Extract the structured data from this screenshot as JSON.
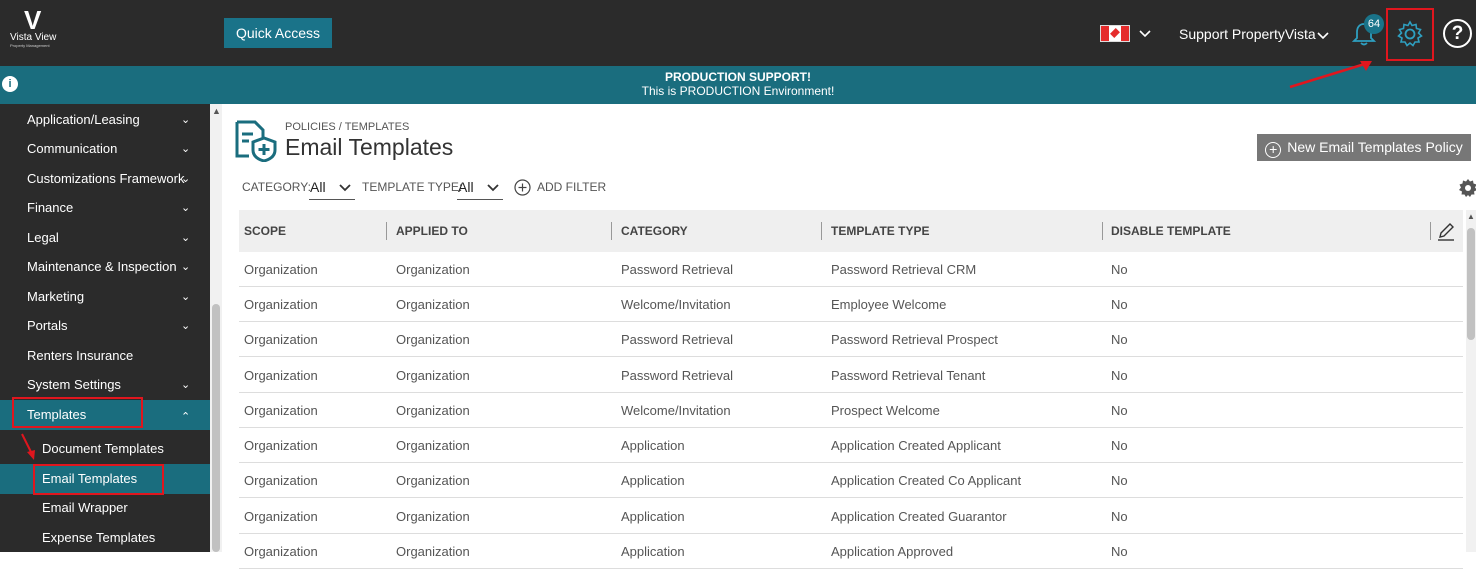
{
  "logo": {
    "mark": "V",
    "line1": "Vista View",
    "line2": "Property Management"
  },
  "topbar": {
    "quick_access": "Quick Access",
    "account": "Support PropertyVista",
    "notifications": "64",
    "help": "?"
  },
  "banner": {
    "line1": "PRODUCTION SUPPORT!",
    "line2": "This is PRODUCTION Environment!",
    "info": "i"
  },
  "sidebar": {
    "items": [
      {
        "label": "Application/Leasing"
      },
      {
        "label": "Communication"
      },
      {
        "label": "Customizations Framework"
      },
      {
        "label": "Finance"
      },
      {
        "label": "Legal"
      },
      {
        "label": "Maintenance & Inspection"
      },
      {
        "label": "Marketing"
      },
      {
        "label": "Portals"
      },
      {
        "label": "Renters Insurance"
      },
      {
        "label": "System Settings"
      },
      {
        "label": "Templates"
      }
    ],
    "subitems": [
      {
        "label": "Document Templates"
      },
      {
        "label": "Email Templates"
      },
      {
        "label": "Email Wrapper"
      },
      {
        "label": "Expense Templates"
      }
    ]
  },
  "page": {
    "breadcrumb": "POLICIES / TEMPLATES",
    "title": "Email Templates",
    "new_button": "New Email Templates Policy"
  },
  "filters": {
    "category_label": "CATEGORY:",
    "category_value": "All",
    "type_label": "TEMPLATE TYPE:",
    "type_value": "All",
    "add_filter": "ADD FILTER"
  },
  "table": {
    "headers": [
      "SCOPE",
      "APPLIED TO",
      "CATEGORY",
      "TEMPLATE TYPE",
      "DISABLE TEMPLATE"
    ],
    "rows": [
      [
        "Organization",
        "Organization",
        "Password Retrieval",
        "Password Retrieval CRM",
        "No"
      ],
      [
        "Organization",
        "Organization",
        "Welcome/Invitation",
        "Employee Welcome",
        "No"
      ],
      [
        "Organization",
        "Organization",
        "Password Retrieval",
        "Password Retrieval Prospect",
        "No"
      ],
      [
        "Organization",
        "Organization",
        "Password Retrieval",
        "Password Retrieval Tenant",
        "No"
      ],
      [
        "Organization",
        "Organization",
        "Welcome/Invitation",
        "Prospect Welcome",
        "No"
      ],
      [
        "Organization",
        "Organization",
        "Application",
        "Application Created Applicant",
        "No"
      ],
      [
        "Organization",
        "Organization",
        "Application",
        "Application Created Co Applicant",
        "No"
      ],
      [
        "Organization",
        "Organization",
        "Application",
        "Application Created Guarantor",
        "No"
      ],
      [
        "Organization",
        "Organization",
        "Application",
        "Application Approved",
        "No"
      ]
    ]
  }
}
